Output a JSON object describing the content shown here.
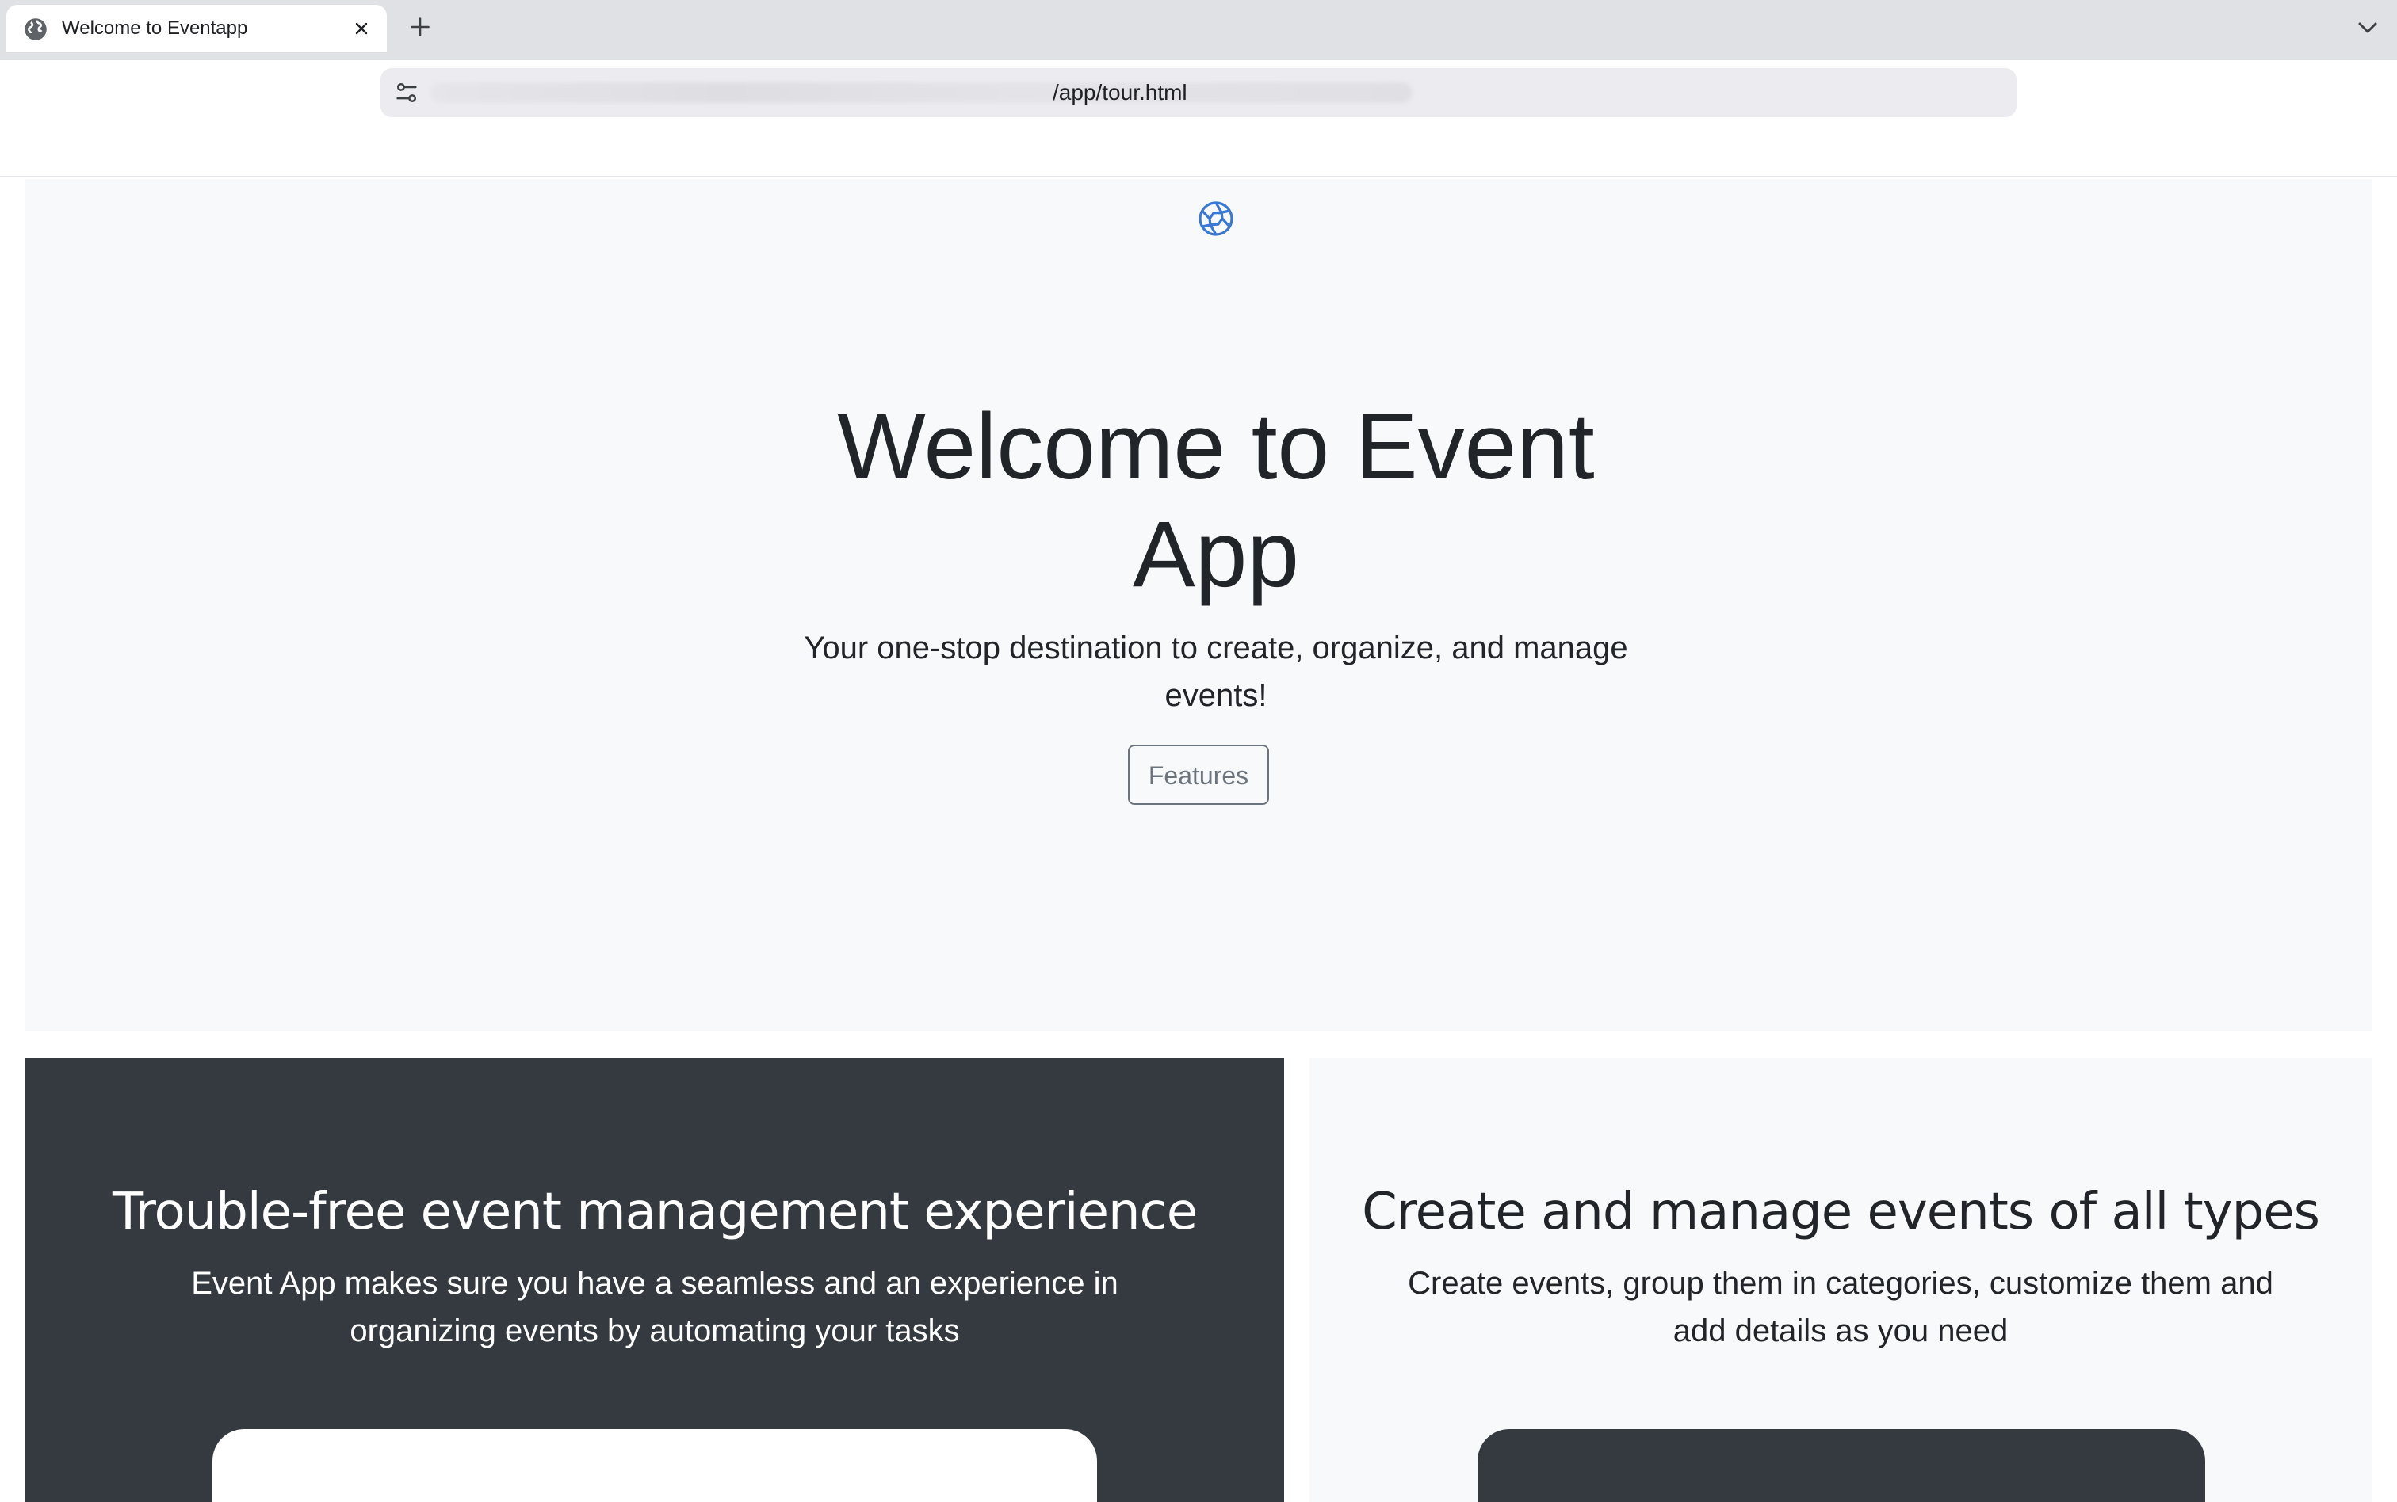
{
  "browser": {
    "tab_title": "Welcome to Eventapp",
    "url_path": "/app/tour.html"
  },
  "hero": {
    "heading": "Welcome to Event App",
    "lead": "Your one-stop destination to create, organize, and manage events!",
    "features_button": "Features"
  },
  "panels": [
    {
      "heading": "Trouble-free event management experience",
      "description": "Event App makes sure you have a seamless and an experience in organizing events by automating your tasks"
    },
    {
      "heading": "Create and manage events of all types",
      "description": "Create events, group them in categories, customize them and add details as you need"
    }
  ],
  "colors": {
    "accent": "#3a78d6",
    "dark_panel": "#343a40",
    "light_bg": "#f8f9fa",
    "secondary": "#6c757d"
  },
  "icons": [
    "globe-icon",
    "close-icon",
    "plus-icon",
    "chevron-down-icon",
    "tune-icon",
    "aperture-logo-icon"
  ]
}
